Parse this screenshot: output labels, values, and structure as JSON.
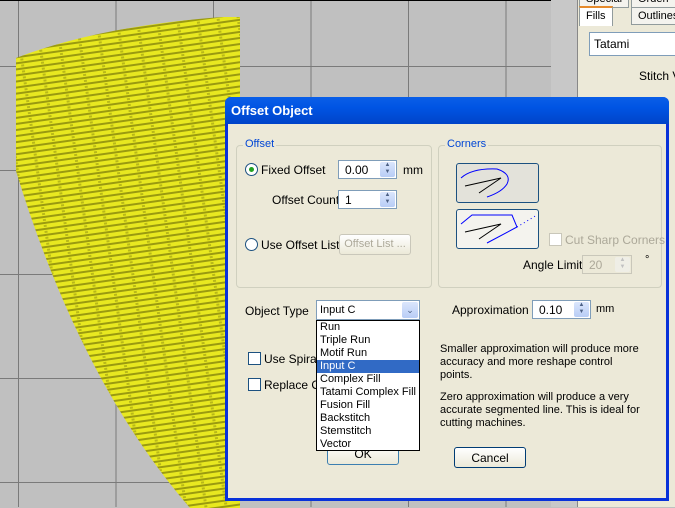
{
  "right_panel": {
    "tabs": [
      "Special",
      "Orderi",
      "Fills",
      "Outlines"
    ],
    "fill_type": "Tatami",
    "stitch_label": "Stitch V"
  },
  "dialog": {
    "title": "Offset Object",
    "offset_group": {
      "label": "Offset",
      "fixed_offset_label": "Fixed Offset",
      "fixed_offset_value": "0.00",
      "fixed_offset_unit": "mm",
      "fixed_offset_selected": true,
      "offset_count_label": "Offset Count",
      "offset_count_value": "1",
      "use_offset_list_label": "Use Offset List",
      "offset_list_button": "Offset List ..."
    },
    "corners_group": {
      "label": "Corners",
      "cut_sharp_corners_label": "Cut Sharp Corners",
      "angle_limit_label": "Angle Limit",
      "angle_limit_value": "20",
      "angle_unit": "°"
    },
    "object_type_label": "Object Type",
    "object_type_value": "Input C",
    "object_type_options": [
      "Run",
      "Triple Run",
      "Motif Run",
      "Input C",
      "Complex Fill",
      "Tatami Complex Fill",
      "Fusion Fill",
      "Backstitch",
      "Stemstitch",
      "Vector"
    ],
    "approximation_label": "Approximation",
    "approximation_value": "0.10",
    "approximation_unit": "mm",
    "use_spiral_label": "Use Spiral",
    "replace_label": "Replace O",
    "desc1": "Smaller approximation will produce more accuracy and more reshape control points.",
    "desc2": "Zero approximation will produce a very accurate segmented line. This is ideal for cutting machines.",
    "ok_label": "OK",
    "cancel_label": "Cancel"
  },
  "colors": {
    "fill": "#f0f020",
    "title_bar": "#0054e3",
    "selection": "#316ac5"
  }
}
